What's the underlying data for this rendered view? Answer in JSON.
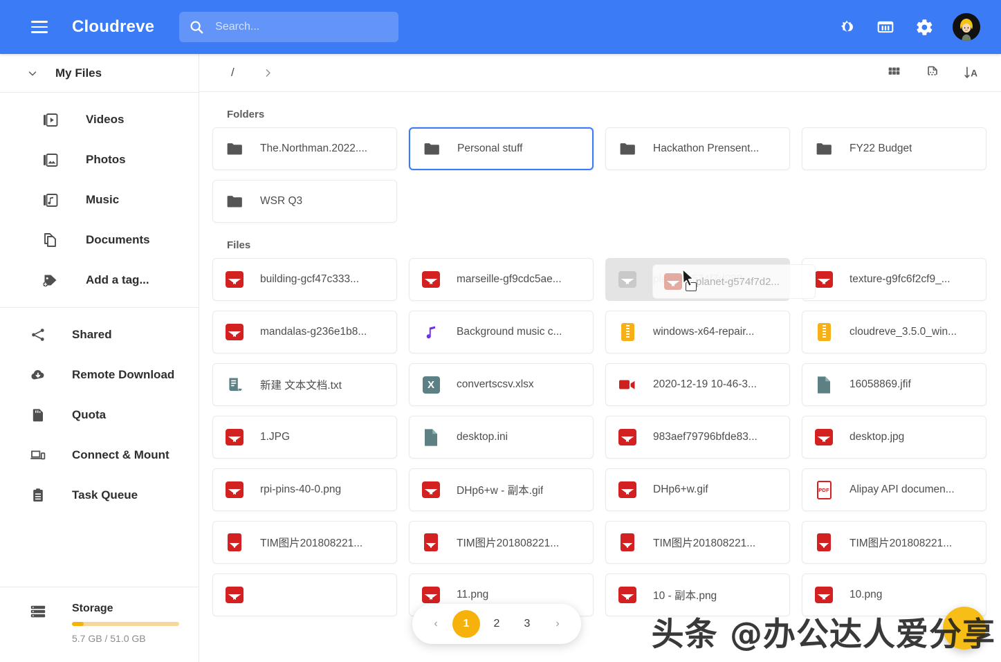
{
  "app": {
    "brand": "Cloudreve",
    "accent_blue": "#3b7bf6",
    "accent_amber": "#f6b10b"
  },
  "header": {
    "menu_icon": "hamburger-menu-icon",
    "search": {
      "placeholder": "Search...",
      "value": "",
      "icon": "search-icon"
    },
    "actions": [
      {
        "name": "dark-mode-toggle",
        "icon": "brightness-sun-moon-icon"
      },
      {
        "name": "capacity-button",
        "icon": "storage-card-icon"
      },
      {
        "name": "settings-button",
        "icon": "gear-icon"
      },
      {
        "name": "user-avatar",
        "icon": "avatar"
      }
    ]
  },
  "sidebar": {
    "my_files": {
      "label": "My Files",
      "icon": "chevron-down-icon"
    },
    "categories": [
      {
        "label": "Videos",
        "icon": "videos-icon"
      },
      {
        "label": "Photos",
        "icon": "photos-icon"
      },
      {
        "label": "Music",
        "icon": "music-icon"
      },
      {
        "label": "Documents",
        "icon": "documents-icon"
      },
      {
        "label": "Add a tag...",
        "icon": "add-tag-icon"
      }
    ],
    "links": [
      {
        "label": "Shared",
        "icon": "share-icon"
      },
      {
        "label": "Remote Download",
        "icon": "cloud-download-icon"
      },
      {
        "label": "Quota",
        "icon": "sd-card-icon"
      },
      {
        "label": "Connect & Mount",
        "icon": "devices-icon"
      },
      {
        "label": "Task Queue",
        "icon": "clipboard-list-icon"
      }
    ],
    "storage": {
      "title": "Storage",
      "icon": "server-storage-icon",
      "used_text": "5.7 GB / 51.0 GB",
      "percent": 11
    }
  },
  "toolbar": {
    "breadcrumb_root": "/",
    "breadcrumb_chevron": "chevron-right-icon",
    "actions": [
      {
        "name": "grid-view-button",
        "icon": "grid-view-icon"
      },
      {
        "name": "new-file-button",
        "icon": "new-file-icon"
      },
      {
        "name": "sort-button",
        "icon": "sort-alpha-icon"
      }
    ]
  },
  "main": {
    "folders_heading": "Folders",
    "files_heading": "Files",
    "folders": [
      {
        "label": "The.Northman.2022....",
        "icon": "folder-icon",
        "state": "normal"
      },
      {
        "label": "Personal stuff",
        "icon": "folder-icon",
        "state": "selected"
      },
      {
        "label": "Hackathon Prensent...",
        "icon": "folder-icon",
        "state": "normal"
      },
      {
        "label": "FY22 Budget",
        "icon": "folder-icon",
        "state": "normal"
      },
      {
        "label": "WSR Q3",
        "icon": "folder-icon",
        "state": "normal"
      }
    ],
    "files": [
      {
        "label": "building-gcf47c333...",
        "icon": "image-file-icon",
        "state": "normal"
      },
      {
        "label": "marseille-gf9cdc5ae...",
        "icon": "image-file-icon",
        "state": "normal"
      },
      {
        "label": "planet-g574f7d288_...",
        "icon": "image-file-icon",
        "state": "dragging"
      },
      {
        "label": "texture-g9fc6f2cf9_...",
        "icon": "image-file-icon",
        "state": "normal"
      },
      {
        "label": "mandalas-g236e1b8...",
        "icon": "image-file-icon",
        "state": "normal"
      },
      {
        "label": "Background music c...",
        "icon": "music-file-icon",
        "state": "normal"
      },
      {
        "label": "windows-x64-repair...",
        "icon": "archive-file-icon",
        "state": "normal"
      },
      {
        "label": "cloudreve_3.5.0_win...",
        "icon": "archive-file-icon",
        "state": "normal"
      },
      {
        "label": "新建 文本文档.txt",
        "icon": "text-file-icon",
        "state": "normal"
      },
      {
        "label": "convertscsv.xlsx",
        "icon": "excel-file-icon",
        "state": "normal"
      },
      {
        "label": "2020-12-19 10-46-3...",
        "icon": "video-file-icon",
        "state": "normal"
      },
      {
        "label": "16058869.jfif",
        "icon": "generic-file-icon",
        "state": "normal"
      },
      {
        "label": "1.JPG",
        "icon": "image-file-icon",
        "state": "normal"
      },
      {
        "label": "desktop.ini",
        "icon": "generic-file-icon",
        "state": "normal"
      },
      {
        "label": "983aef79796bfde83...",
        "icon": "image-file-icon",
        "state": "normal"
      },
      {
        "label": "desktop.jpg",
        "icon": "image-file-icon",
        "state": "normal"
      },
      {
        "label": "rpi-pins-40-0.png",
        "icon": "image-file-icon",
        "state": "normal"
      },
      {
        "label": "DHp6+w - 副本.gif",
        "icon": "image-file-icon",
        "state": "normal"
      },
      {
        "label": "DHp6+w.gif",
        "icon": "image-file-icon",
        "state": "normal"
      },
      {
        "label": "Alipay API documen...",
        "icon": "pdf-file-icon",
        "state": "normal"
      },
      {
        "label": "TIM图片201808221...",
        "icon": "image-file-tall-icon",
        "state": "normal"
      },
      {
        "label": "TIM图片201808221...",
        "icon": "image-file-tall-icon",
        "state": "normal"
      },
      {
        "label": "TIM图片201808221...",
        "icon": "image-file-tall-icon",
        "state": "normal"
      },
      {
        "label": "TIM图片201808221...",
        "icon": "image-file-tall-icon",
        "state": "normal"
      },
      {
        "label": "",
        "icon": "image-file-icon",
        "state": "normal"
      },
      {
        "label": "11.png",
        "icon": "image-file-icon",
        "state": "normal"
      },
      {
        "label": "10 - 副本.png",
        "icon": "image-file-icon",
        "state": "normal"
      },
      {
        "label": "10.png",
        "icon": "image-file-icon",
        "state": "normal"
      }
    ],
    "drag": {
      "label": "planet-g574f7d2...",
      "icon": "image-file-icon",
      "target_folder": "Personal stuff"
    }
  },
  "pagination": {
    "prev": "‹",
    "next": "›",
    "pages": [
      "1",
      "2",
      "3"
    ],
    "current": "1"
  },
  "fab": {
    "name": "upload-fab",
    "icon": "add-icon"
  },
  "watermark": {
    "text": "头条 @办公达人爱分享"
  }
}
